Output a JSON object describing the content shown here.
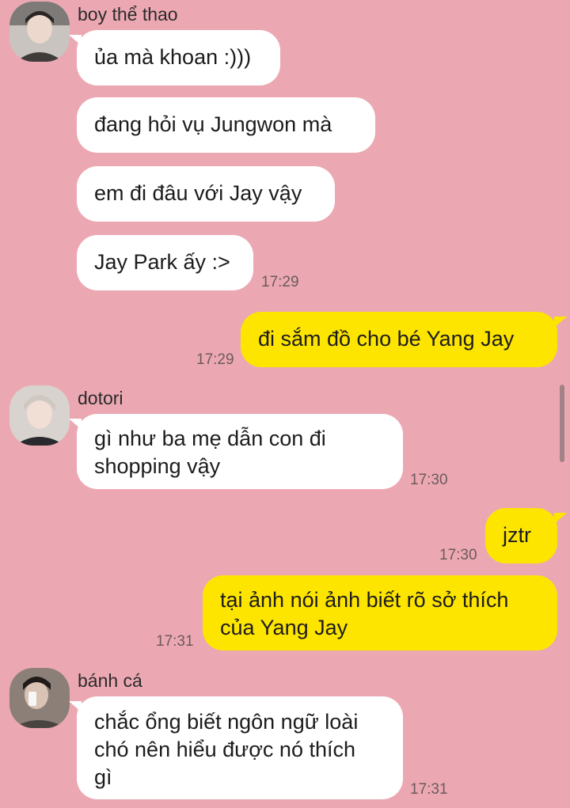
{
  "colors": {
    "background": "#eca8b2",
    "incoming_bubble": "#ffffff",
    "outgoing_bubble": "#fee500",
    "timestamp": "#6b5a5d"
  },
  "groups": [
    {
      "sender": "boy thể thao",
      "avatar_icon": "avatar-photo",
      "messages": [
        {
          "text": "ủa mà khoan :)))"
        },
        {
          "text": "đang hỏi vụ Jungwon mà"
        },
        {
          "text": "em đi đâu với Jay vậy"
        },
        {
          "text": "Jay Park ấy :>",
          "time": "17:29"
        }
      ]
    },
    {
      "outgoing": true,
      "messages": [
        {
          "text": "đi sắm đồ cho bé Yang Jay",
          "time": "17:29"
        }
      ]
    },
    {
      "sender": "dotori",
      "avatar_icon": "avatar-photo",
      "messages": [
        {
          "lines": [
            "gì như ba mẹ dẫn con đi",
            "shopping vậy"
          ],
          "time": "17:30"
        }
      ]
    },
    {
      "outgoing": true,
      "messages": [
        {
          "text": "jztr",
          "time": "17:30"
        },
        {
          "lines": [
            "tại ảnh nói ảnh biết rõ sở thích",
            "của Yang Jay"
          ],
          "time": "17:31"
        }
      ]
    },
    {
      "sender": "bánh cá",
      "avatar_icon": "avatar-photo",
      "messages": [
        {
          "lines": [
            "chắc ổng biết ngôn ngữ loài",
            "chó nên hiểu được nó thích",
            "gì"
          ],
          "time": "17:31"
        }
      ]
    }
  ]
}
